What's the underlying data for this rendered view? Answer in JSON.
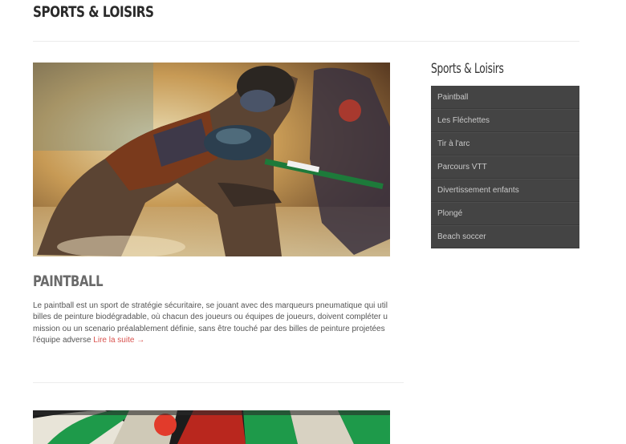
{
  "header": {
    "title": "SPORTS & LOISIRS"
  },
  "post": {
    "title": "PAINTBALL",
    "excerpt_lines": [
      "Le paintball est un sport de stratégie sécuritaire, se jouant avec des marqueurs pneumatique qui util",
      "billes de peinture biodégradable, où chacun des joueurs ou équipes de joueurs, doivent compléter u",
      "mission ou un scenario préalablement définie, sans être touché par des billes de peinture projetées",
      "l'équipe adverse"
    ],
    "read_more": "Lire la suite →"
  },
  "sidebar": {
    "title": "Sports & Loisirs",
    "items": [
      {
        "label": "Paintball"
      },
      {
        "label": "Les Fléchettes"
      },
      {
        "label": "Tir à l'arc"
      },
      {
        "label": "Parcours VTT"
      },
      {
        "label": "Divertissement enfants"
      },
      {
        "label": "Plongé"
      },
      {
        "label": "Beach soccer"
      }
    ]
  }
}
